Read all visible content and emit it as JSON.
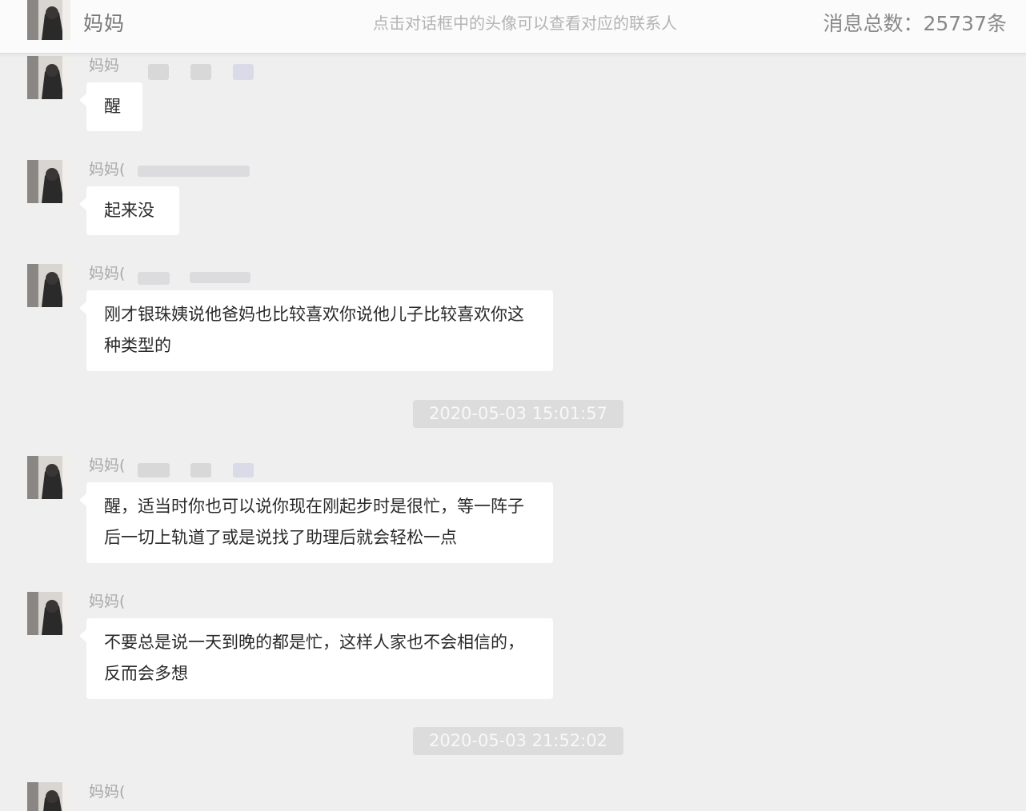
{
  "header": {
    "contact_name": "妈妈",
    "hint": "点击对话框中的头像可以查看对应的联系人",
    "message_count": "消息总数：25737条"
  },
  "messages": [
    {
      "sender": "妈妈",
      "text": "醒"
    },
    {
      "sender": "妈妈(",
      "text": "起来没"
    },
    {
      "sender": "妈妈(",
      "text": "刚才银珠姨说他爸妈也比较喜欢你说他儿子比较喜欢你这种类型的"
    },
    {
      "sender": "妈妈(",
      "text": "醒，适当时你也可以说你现在刚起步时是很忙，等一阵子后一切上轨道了或是说找了助理后就会轻松一点"
    },
    {
      "sender": "妈妈(",
      "text": "不要总是说一天到晚的都是忙，这样人家也不会相信的，反而会多想"
    },
    {
      "sender": "妈妈("
    }
  ],
  "timestamps": [
    "2020-05-03 15:01:57",
    "2020-05-03 21:52:02"
  ],
  "colors": {
    "background": "#efefef",
    "header_bg": "#fbfbfb",
    "bubble_bg": "#ffffff",
    "timestamp_bg": "#dcdcdc"
  }
}
